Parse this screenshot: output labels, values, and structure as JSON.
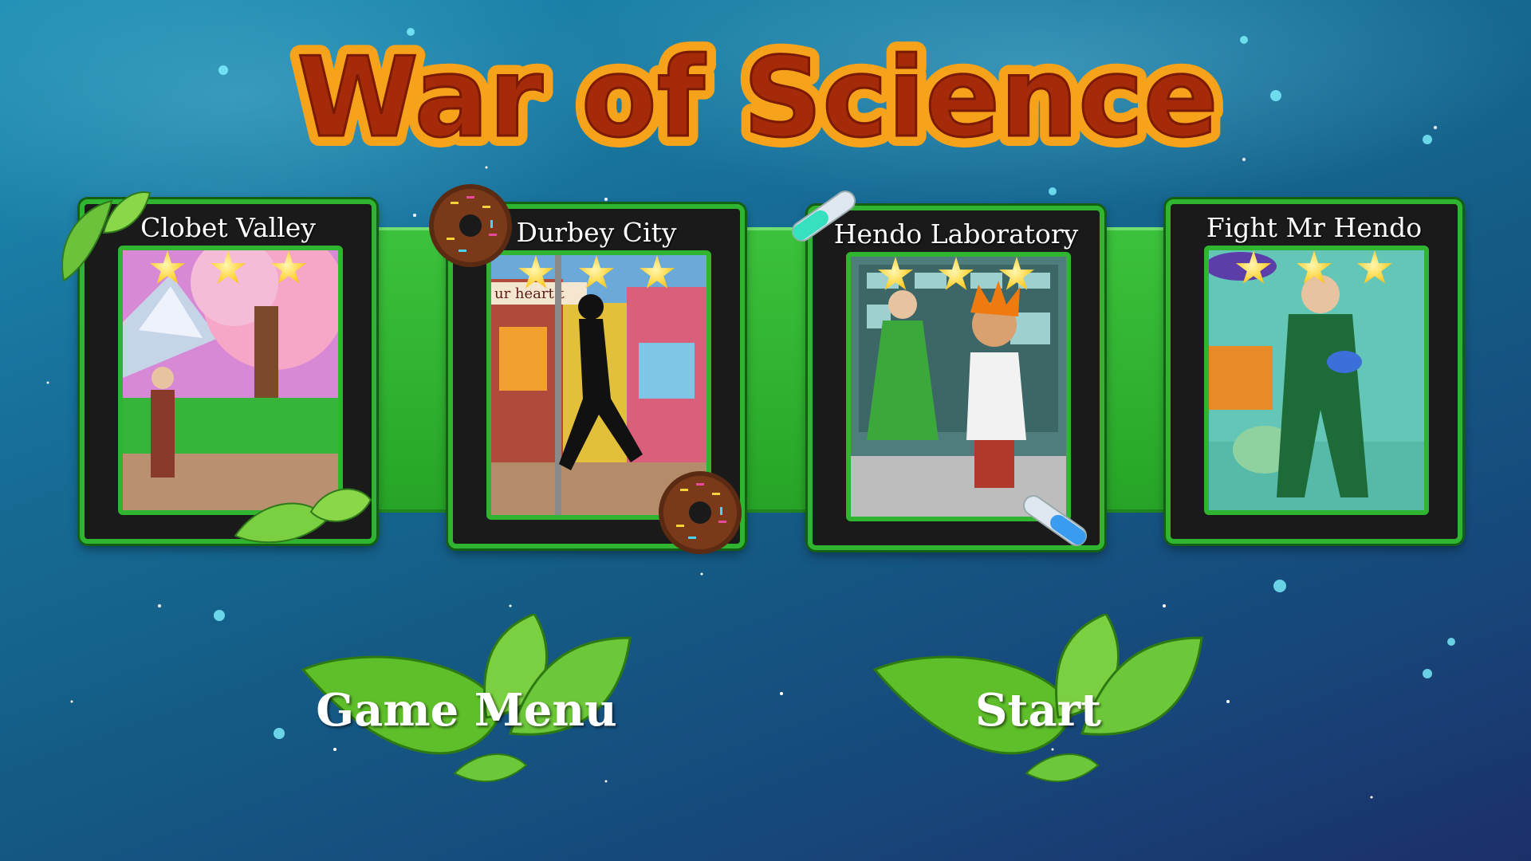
{
  "game": {
    "title": "War of Science"
  },
  "levels": [
    {
      "name": "Clobet Valley",
      "stars": 3
    },
    {
      "name": "Durbey City",
      "stars": 3,
      "shop_sign": "ur heart  t"
    },
    {
      "name": "Hendo Laboratory",
      "stars": 3
    },
    {
      "name": "Fight Mr Hendo",
      "stars": 3
    }
  ],
  "buttons": {
    "game_menu": "Game Menu",
    "start": "Start"
  },
  "colors": {
    "card_border": "#2fb52f",
    "band": "#3cc23c",
    "title_fill": "#a52a0a",
    "title_outline": "#f7a21b"
  }
}
